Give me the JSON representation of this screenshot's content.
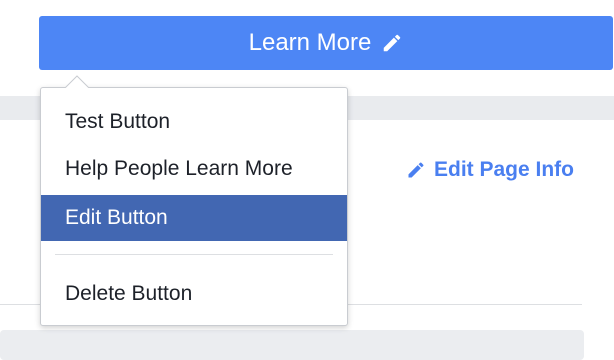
{
  "cta": {
    "label": "Learn More",
    "icon": "pencil-icon",
    "color": "#4d86f5"
  },
  "edit_page_info": {
    "label": "Edit Page Info",
    "icon": "pencil-icon",
    "color": "#4a7ff0"
  },
  "menu": {
    "items": [
      {
        "label": "Test Button"
      },
      {
        "label": "Help People Learn More"
      },
      {
        "label": "Edit Button",
        "selected": true
      },
      {
        "label": "Delete Button"
      }
    ],
    "highlight_color": "#4267b2"
  }
}
